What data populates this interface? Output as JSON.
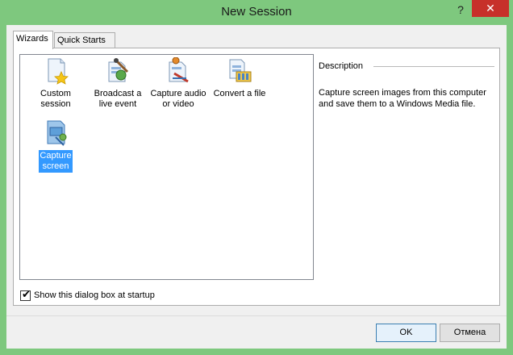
{
  "window": {
    "title": "New Session",
    "help_glyph": "?",
    "close_glyph": "✕"
  },
  "tabs": [
    {
      "label": "Wizards",
      "active": true
    },
    {
      "label": "Quick Starts",
      "active": false
    }
  ],
  "wizards": [
    {
      "icon": "custom-session-icon",
      "label_line1": "Custom",
      "label_line2": "session",
      "selected": false
    },
    {
      "icon": "broadcast-icon",
      "label_line1": "Broadcast a",
      "label_line2": "live event",
      "selected": false
    },
    {
      "icon": "capture-av-icon",
      "label_line1": "Capture audio",
      "label_line2": "or video",
      "selected": false
    },
    {
      "icon": "convert-file-icon",
      "label_line1": "Convert a file",
      "label_line2": "",
      "selected": false
    },
    {
      "icon": "capture-screen-icon",
      "label_line1": "Capture",
      "label_line2": "screen",
      "selected": true
    }
  ],
  "description": {
    "header": "Description",
    "text": "Capture screen images from this computer and save them to a Windows Media file."
  },
  "startup_checkbox": {
    "label": "Show this dialog box at startup",
    "checked": true,
    "mark": "✔"
  },
  "buttons": {
    "ok": "OK",
    "cancel": "Отмена"
  },
  "colors": {
    "frame": "#7ec87e",
    "close": "#c7302a",
    "selection": "#3399ff"
  }
}
